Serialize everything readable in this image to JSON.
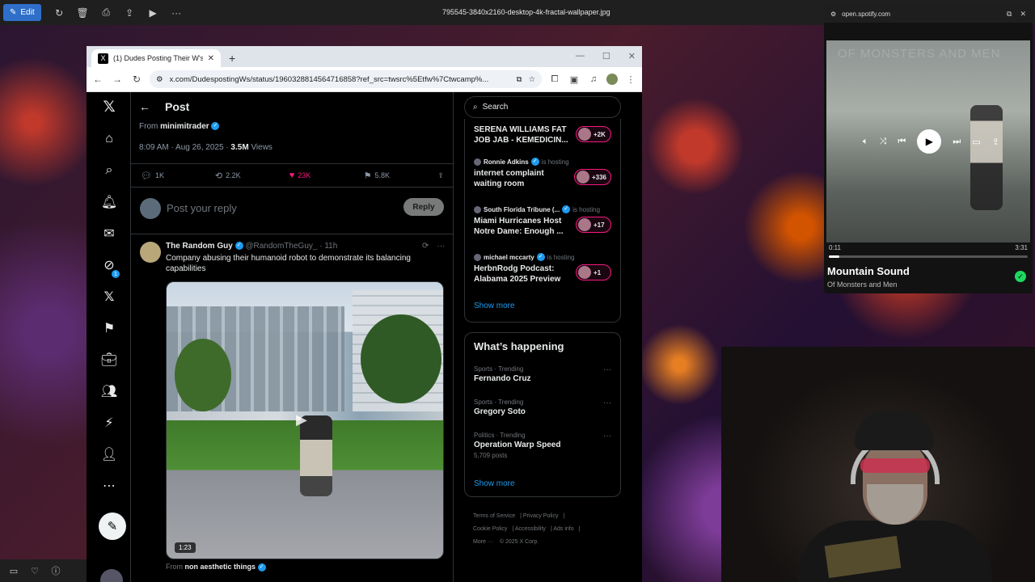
{
  "viewer": {
    "edit_label": "Edit",
    "file_name": "795545-3840x2160-desktop-4k-fractal-wallpaper.jpg"
  },
  "browser": {
    "tab_title": "(1) Dudes Posting Their W's on",
    "tab_logo": "X",
    "url": "x.com/DudespostingWs/status/1960328814564716858?ref_src=twsrc%5Etfw%7Ctwcamp%..."
  },
  "post": {
    "header_title": "Post",
    "from_prefix": "From",
    "from_user": "minimitrader",
    "time": "8:09 AM · Aug 26, 2025 ·",
    "views_count": "3.5M",
    "views_label": "Views",
    "stats": {
      "replies": "1K",
      "reposts": "2.2K",
      "likes": "23K",
      "bookmarks": "5.8K"
    },
    "reply_placeholder": "Post your reply",
    "reply_button": "Reply"
  },
  "tweet": {
    "author": "The Random Guy",
    "handle": "@RandomTheGuy_",
    "age": "· 11h",
    "text": "Company abusing their humanoid robot to demonstrate its balancing capabilities",
    "duration": "1:23",
    "from_prefix": "From",
    "from_user": "non aesthetic things"
  },
  "sidebar": {
    "search_placeholder": "Search",
    "spaces": [
      {
        "host": "",
        "hosting": "",
        "title": "SERENA WILLIAMS FAT JOB JAB - KEMEDICIN...",
        "count": "+2K"
      },
      {
        "host": "Ronnie Adkins",
        "hosting": "is hosting",
        "title": "internet complaint waiting room",
        "count": "+336"
      },
      {
        "host": "South Florida Tribune (...",
        "hosting": "is hosting",
        "title": "Miami Hurricanes Host Notre Dame: Enough ...",
        "count": "+17"
      },
      {
        "host": "michael mccarty",
        "hosting": "is hosting",
        "title": "HerbnRodg Podcast: Alabama 2025 Preview",
        "count": "+1"
      }
    ],
    "show_more": "Show more",
    "happening_title": "What’s happening",
    "trends": [
      {
        "category": "Sports · Trending",
        "name": "Fernando Cruz",
        "posts": ""
      },
      {
        "category": "Sports · Trending",
        "name": "Gregory Soto",
        "posts": ""
      },
      {
        "category": "Politics · Trending",
        "name": "Operation Warp Speed",
        "posts": "5,709 posts"
      }
    ],
    "happening_show_more": "Show more",
    "footer": {
      "terms": "Terms of Service",
      "privacy": "Privacy Policy",
      "cookie": "Cookie Policy",
      "accessibility": "Accessibility",
      "ads": "Ads info",
      "more": "More ···",
      "copyright": "© 2025 X Corp."
    }
  },
  "nav": {
    "messages_badge": "1"
  },
  "spotify": {
    "site": "open.spotify.com",
    "art_text": "OF MONSTERS AND MEN",
    "elapsed": "0:11",
    "duration": "3:31",
    "progress": 0.052,
    "track": "Mountain Sound",
    "artist": "Of Monsters and Men"
  },
  "colors": {
    "accent": "#1d9bf0",
    "like": "#f91880",
    "spotify_green": "#1ed760"
  }
}
